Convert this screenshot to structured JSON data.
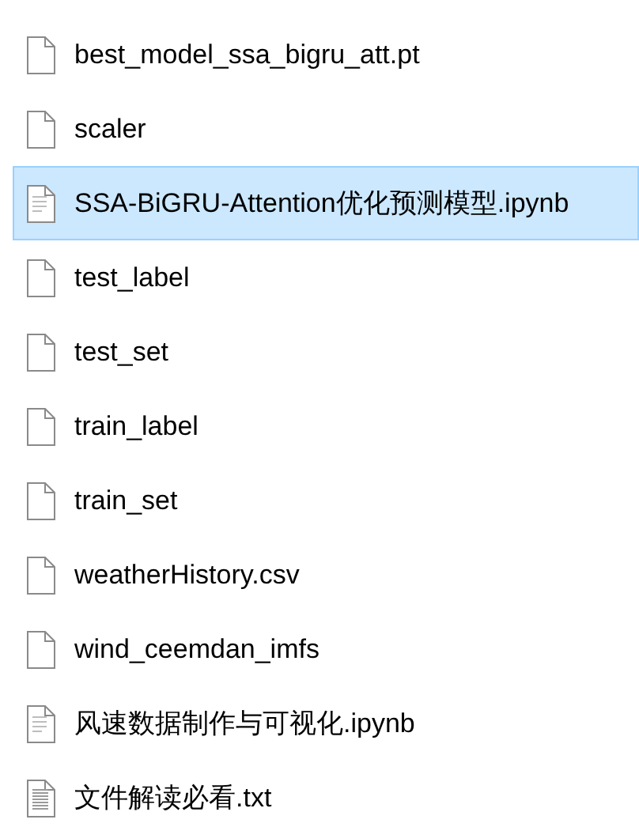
{
  "files": [
    {
      "name": "best_model_ssa_bigru_att.pt",
      "kind": "blank",
      "selected": false
    },
    {
      "name": "scaler",
      "kind": "blank",
      "selected": false
    },
    {
      "name": "SSA-BiGRU-Attention优化预测模型.ipynb",
      "kind": "lined",
      "selected": true
    },
    {
      "name": "test_label",
      "kind": "blank",
      "selected": false
    },
    {
      "name": "test_set",
      "kind": "blank",
      "selected": false
    },
    {
      "name": "train_label",
      "kind": "blank",
      "selected": false
    },
    {
      "name": "train_set",
      "kind": "blank",
      "selected": false
    },
    {
      "name": "weatherHistory.csv",
      "kind": "blank",
      "selected": false
    },
    {
      "name": "wind_ceemdan_imfs",
      "kind": "blank",
      "selected": false
    },
    {
      "name": "风速数据制作与可视化.ipynb",
      "kind": "lined",
      "selected": false
    },
    {
      "name": "文件解读必看.txt",
      "kind": "text",
      "selected": false
    }
  ]
}
